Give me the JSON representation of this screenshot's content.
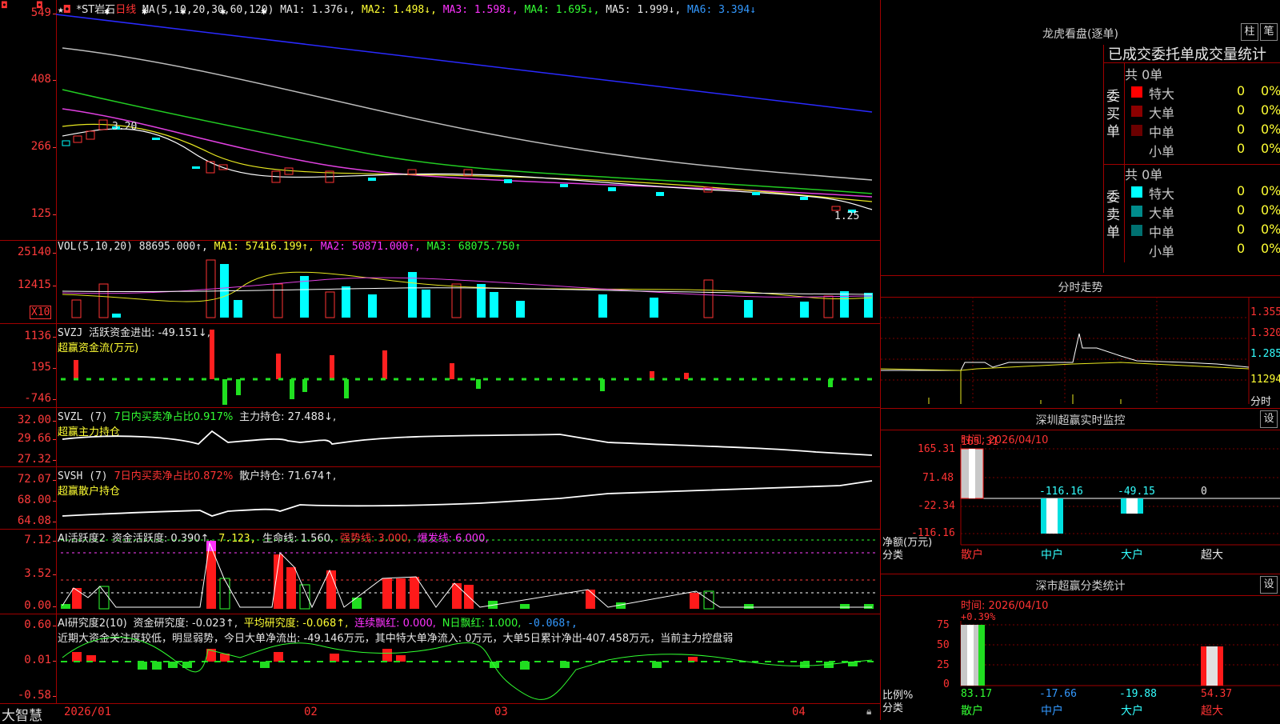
{
  "window": {
    "brand": "大智慧"
  },
  "main": {
    "header": {
      "stock": "*ST岩石",
      "period": "日线",
      "ma_prefix": "MA(5,10,20,30,60,120)",
      "ma1": "MA1: 1.376↓,",
      "ma2": "MA2: 1.498↓,",
      "ma3": "MA3: 1.598↓,",
      "ma4": "MA4: 1.695↓,",
      "ma5": "MA5: 1.999↓,",
      "ma6": "MA6: 3.394↓"
    },
    "yticks": [
      "549",
      "408",
      "266",
      "125"
    ],
    "annotations": {
      "high": "3.20",
      "low": "1.25"
    }
  },
  "vol": {
    "header": {
      "name": "VOL(5,10,20)",
      "val": "88695.000↑,",
      "ma1": "MA1: 57416.199↑,",
      "ma2": "MA2: 50871.000↑,",
      "ma3": "MA3: 68075.750↑"
    },
    "yticks": [
      "25140",
      "12415"
    ],
    "unit": "X10"
  },
  "svzj": {
    "header": {
      "name": "SVZJ",
      "label": "活跃资金进出: -49.151↓,",
      "sub": "超赢资金流(万元)"
    },
    "yticks": [
      "1136",
      "195",
      "-746"
    ]
  },
  "svzl": {
    "header": {
      "name": "SVZL (7)",
      "ratio": "7日内买卖净占比0.917%",
      "hold": "主力持仓: 27.488↓,",
      "sub": "超赢主力持仓"
    },
    "yticks": [
      "32.00",
      "29.66",
      "27.32"
    ]
  },
  "svsh": {
    "header": {
      "name": "SVSH (7)",
      "ratio": "7日内买卖净占比0.872%",
      "hold": "散户持仓: 71.674↑,",
      "sub": "超赢散户持仓"
    },
    "yticks": [
      "72.07",
      "68.00",
      "64.08"
    ]
  },
  "ai1": {
    "header": {
      "name": "AI活跃度2",
      "a": "资金活跃度: 0.390↑,",
      "b": "7.123,",
      "c": "生命线: 1.560,",
      "d": "强势线: 3.000,",
      "e": "爆发线: 6.000,"
    },
    "yticks": [
      "7.12",
      "3.52",
      "0.00"
    ]
  },
  "ai2": {
    "header": {
      "name": "AI研究度2(10)",
      "a": "资金研究度: -0.023↑,",
      "b": "平均研究度: -0.068↑,",
      "c": "连续飘红: 0.000,",
      "d": "N日飘红: 1.000,",
      "e": "-0.068↑,"
    },
    "text": "近期大资金关注度较低，明显弱势，今日大单净流出: -49.146万元，其中特大单净流入: 0万元，大单5日累计净出-407.458万元，当前主力控盘弱",
    "yticks": [
      "0.60",
      "0.01",
      "-0.58"
    ]
  },
  "xaxis": [
    "2026/01",
    "02",
    "03",
    "04"
  ],
  "longhu": {
    "title": "龙虎看盘(逐单)",
    "btn1": "柱",
    "btn2": "笔",
    "subtitle": "已成交委托单成交量统计",
    "buy": {
      "label": "委买单",
      "total": "共 0单",
      "rows": [
        {
          "name": "特大",
          "count": "0",
          "pct": "0%",
          "color": "#ff0000"
        },
        {
          "name": "大单",
          "count": "0",
          "pct": "0%",
          "color": "#8b0000"
        },
        {
          "name": "中单",
          "count": "0",
          "pct": "0%",
          "color": "#6b0000"
        },
        {
          "name": "小单",
          "count": "0",
          "pct": "0%",
          "color": ""
        }
      ]
    },
    "sell": {
      "label": "委卖单",
      "total": "共 0单",
      "rows": [
        {
          "name": "特大",
          "count": "0",
          "pct": "0%",
          "color": "#00ffff"
        },
        {
          "name": "大单",
          "count": "0",
          "pct": "0%",
          "color": "#008b8b"
        },
        {
          "name": "中单",
          "count": "0",
          "pct": "0%",
          "color": "#007070"
        },
        {
          "name": "小单",
          "count": "0",
          "pct": "0%",
          "color": ""
        }
      ]
    }
  },
  "fenshi": {
    "title": "分时走势",
    "yticks": [
      "1.355",
      "1.320",
      "1.285",
      "11294"
    ],
    "right_label": "分时"
  },
  "sz_monitor": {
    "title": "深圳超赢实时监控",
    "btn": "设",
    "time": "时间: 2026/04/10",
    "yticks": [
      "165.31",
      "71.48",
      "-22.34",
      "-116.16"
    ],
    "labels_y": "净额(万元)",
    "labels_x": "分类",
    "categories": [
      "散户",
      "中户",
      "大户",
      "超大"
    ],
    "values_text": [
      "165.31",
      "-116.16",
      "-49.15",
      "0"
    ]
  },
  "sz_class": {
    "title": "深市超赢分类统计",
    "btn": "设",
    "time": "时间: 2026/04/10",
    "top_pct": "+0.39%",
    "yticks": [
      "75",
      "50",
      "25",
      "0"
    ],
    "labels_y": "比例%",
    "labels_x": "分类",
    "categories": [
      "散户",
      "中户",
      "大户",
      "超大"
    ],
    "values_text": [
      "83.17",
      "-17.66",
      "-19.88",
      "54.37"
    ]
  }
}
